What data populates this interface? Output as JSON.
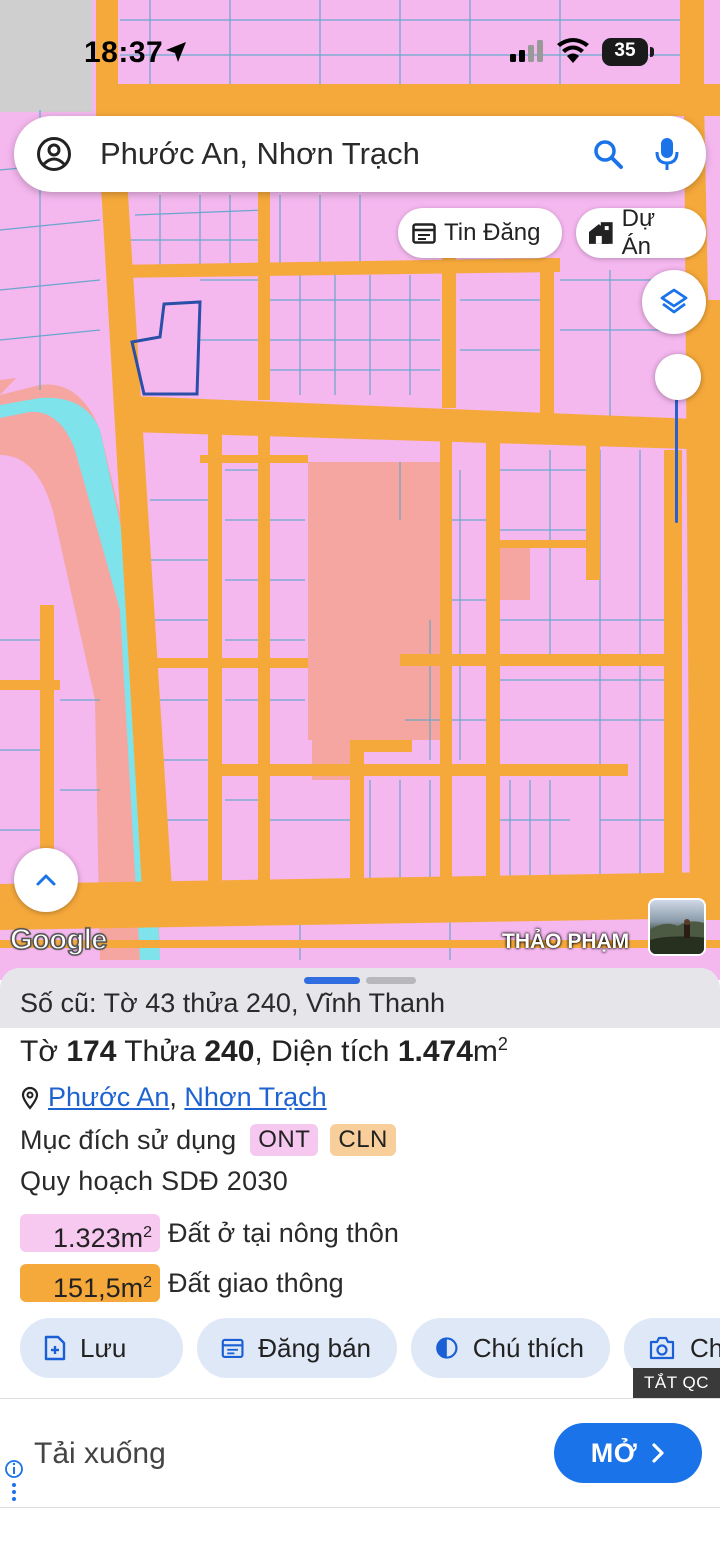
{
  "status_bar": {
    "time": "18:37",
    "battery": "35"
  },
  "search": {
    "query": "Phước An, Nhơn Trạch"
  },
  "map_chips": {
    "listings": "Tin Đăng",
    "projects": "Dự Án"
  },
  "map": {
    "attribution": "Google",
    "photo_credit": "THẢO PHẠM"
  },
  "parcel": {
    "old_number": "Số cũ: Tờ 43 thửa 240, Vĩnh Thanh",
    "sheet_label": "Tờ",
    "sheet_no": "174",
    "plot_label": "Thửa",
    "plot_no": "240",
    "area_label": "Diện tích",
    "area_value": "1.474",
    "area_unit": "m",
    "area_sup": "2",
    "ward": "Phước An",
    "district": "Nhơn Trạch",
    "purpose_label": "Mục đích sử dụng",
    "purpose_tags": [
      "ONT",
      "CLN"
    ],
    "plan_label": "Quy hoạch SDĐ 2030",
    "zones": [
      {
        "area": "1.323m",
        "sup": "2",
        "label": "Đất ở tại nông thôn",
        "color": "#f7c8f0"
      },
      {
        "area": "151,5m",
        "sup": "2",
        "label": "Đất giao thông",
        "color": "#f6a93b"
      }
    ]
  },
  "actions": [
    "Lưu",
    "Đăng bán",
    "Chú thích",
    "Ch"
  ],
  "ad": {
    "close_label": "TẮT QC",
    "title": "Tải xuống",
    "cta": "MỞ"
  },
  "colors": {
    "residential": "#f4b7ee",
    "road": "#f6a93b",
    "water": "#7fe3ec",
    "parcel_line": "#5aa6c9",
    "highlight": "#2a4fa8"
  }
}
